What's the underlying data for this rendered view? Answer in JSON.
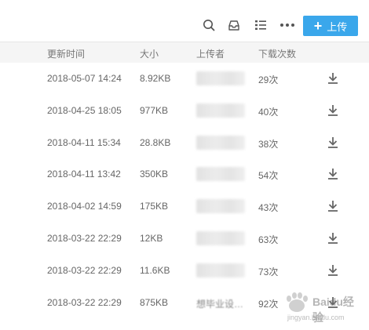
{
  "toolbar": {
    "upload_label": "上传",
    "icons": [
      "search-icon",
      "inbox-icon",
      "list-view-icon",
      "more-icon"
    ]
  },
  "table": {
    "columns": [
      "更新时间",
      "大小",
      "上传者",
      "下载次数"
    ],
    "rows": [
      {
        "time": "2018-05-07 14:24",
        "size": "8.92KB",
        "downloads": "29次"
      },
      {
        "time": "2018-04-25 18:05",
        "size": "977KB",
        "downloads": "40次"
      },
      {
        "time": "2018-04-11 15:34",
        "size": "28.8KB",
        "downloads": "38次"
      },
      {
        "time": "2018-04-11 13:42",
        "size": "350KB",
        "downloads": "54次"
      },
      {
        "time": "2018-04-02 14:59",
        "size": "175KB",
        "downloads": "43次"
      },
      {
        "time": "2018-03-22 22:29",
        "size": "12KB",
        "downloads": "63次"
      },
      {
        "time": "2018-03-22 22:29",
        "size": "11.6KB",
        "downloads": "73次"
      },
      {
        "time": "2018-03-22 22:29",
        "size": "875KB",
        "uploader": "想毕业设…",
        "downloads": "92次"
      }
    ]
  },
  "watermark": {
    "text": "Baidu经验",
    "url": "jingyan.baidu.com"
  },
  "colors": {
    "accent": "#3aa7eb",
    "header_bg": "#f5f5f5"
  }
}
